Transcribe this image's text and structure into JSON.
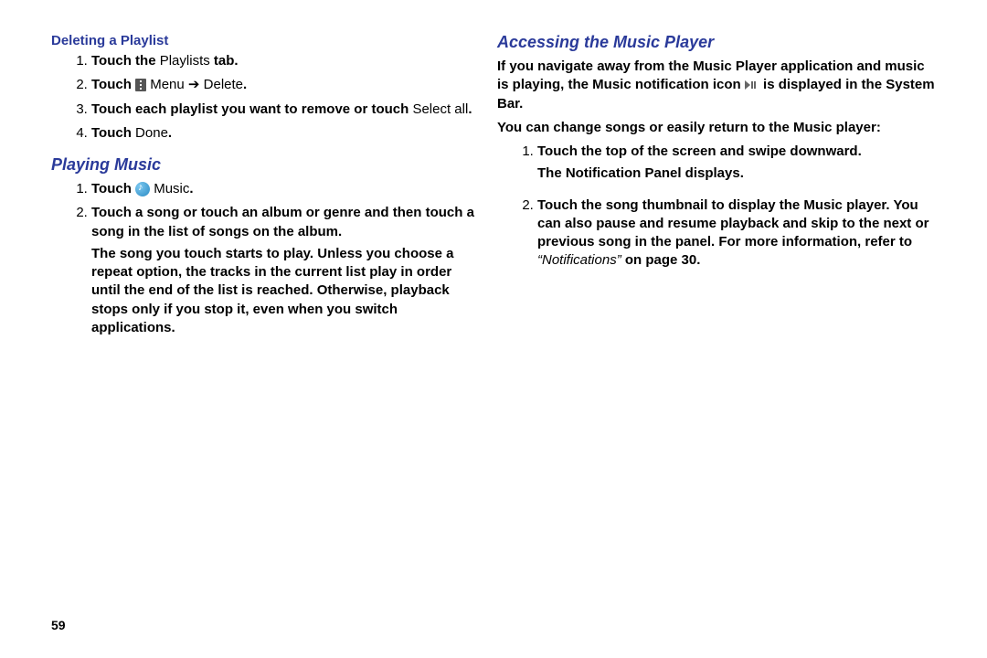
{
  "pageNumber": "59",
  "left": {
    "heading1": "Deleting a Playlist",
    "step1_a": "Touch the ",
    "step1_b": "Playlists ",
    "step1_c": "tab.",
    "step2_a": "Touch ",
    "step2_menu": "Menu",
    "step2_arrow": " ➔ ",
    "step2_delete": "Delete",
    "step2_end": ".",
    "step3_a": "Touch each playlist ",
    "step3_b": "you want to remove or touch ",
    "step3_selectall": "Select all",
    "step3_end": ".",
    "step4_a": "Touch ",
    "step4_done": "Done",
    "step4_end": ".",
    "heading2": "Playing Music",
    "pm_step1_a": "Touch ",
    "pm_step1_music": "Music",
    "pm_step1_end": ".",
    "pm_step2": "Touch a song or touch an album or genre and then touch a song in the list of songs on the album.",
    "pm_step2_body": "The song you touch starts to play. Unless you choose a repeat option, the tracks in the current list play in order until the end of the list is reached. Otherwise, playback stops only if you stop it, even when you switch applications."
  },
  "right": {
    "heading": "Accessing the Music Player",
    "para1a": "If you navigate away from the Music Player application and music is playing, the Music notification icon ",
    "para1b": " is displayed in the System Bar.",
    "para2": "You can change songs or easily return to the Music player:",
    "step1": "Touch the top of the screen and swipe downward.",
    "step1_body": "The Notification Panel displays.",
    "step2a": "Touch the song thumbnail to display the Music player. You can also pause and resume playback and skip to the next or previous song in the panel. For more information, refer to ",
    "step2_ref": "“Notifications”",
    "step2_onpage": " on page 30."
  }
}
